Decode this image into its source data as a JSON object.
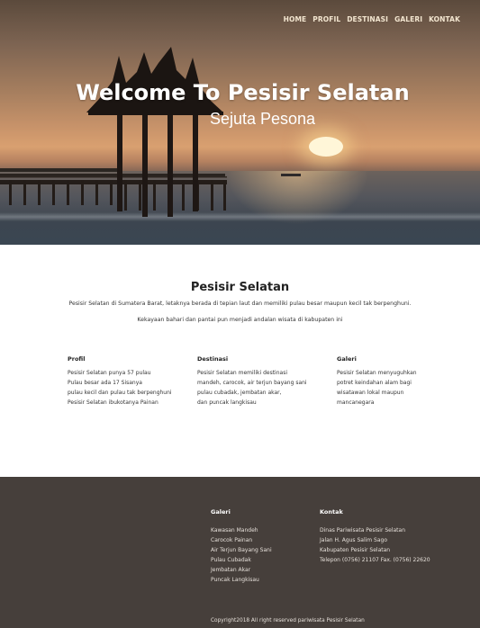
{
  "nav": {
    "items": [
      "HOME",
      "PROFIL",
      "DESTINASI",
      "GALERI",
      "KONTAK"
    ]
  },
  "hero": {
    "title": "Welcome To Pesisir Selatan",
    "subtitle": "Sejuta Pesona"
  },
  "intro": {
    "title": "Pesisir Selatan",
    "line1": "Pesisir Selatan di Sumatera Barat, letaknya berada di tepian laut dan memiliki pulau besar maupun kecil tak berpenghuni.",
    "line2": "Kekayaan bahari dan pantai pun menjadi andalan wisata di kabupaten ini"
  },
  "columns": [
    {
      "heading": "Profil",
      "lines": [
        "Pesisir Selatan punya 57 pulau",
        "Pulau besar ada 17 Sisanya",
        "pulau kecil dan pulau tak berpenghuni",
        "Pesisir Selatan ibukotanya Painan"
      ]
    },
    {
      "heading": "Destinasi",
      "lines": [
        "Pesisir Selatan memiliki destinasi",
        "mandeh, carocok, air terjun bayang sani",
        "pulau cubadak, jembatan akar,",
        "dan puncak langkisau"
      ]
    },
    {
      "heading": "Galeri",
      "lines": [
        "Pesisir Selatan menyuguhkan",
        "potret keindahan alam bagi",
        "wisatawan lokal maupun",
        "mancanegara"
      ]
    }
  ],
  "footer": {
    "galeri": {
      "heading": "Galeri",
      "items": [
        "Kawasan Mandeh",
        "Carocok Painan",
        "Air Terjun Bayang Sani",
        "Pulau Cubadak",
        "Jembatan Akar",
        "Puncak Langkisau"
      ]
    },
    "kontak": {
      "heading": "Kontak",
      "items": [
        "Dinas Pariwisata Pesisir Selatan",
        "Jalan H. Agus Salim Sago",
        "Kabupaten Pesisir Selatan",
        "Telepon (0756) 21107 Fax. (0756) 22620"
      ]
    },
    "copyright": "Copyright2018 All right reserved pariwisata Pesisir Selatan"
  }
}
